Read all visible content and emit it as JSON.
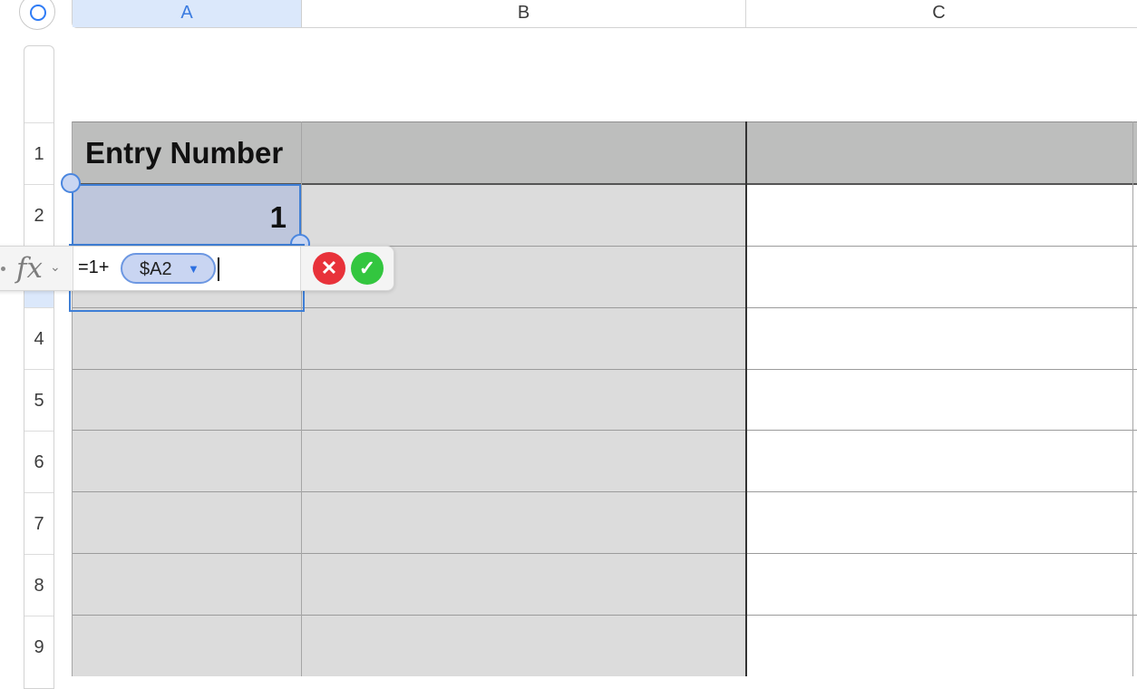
{
  "columns": [
    {
      "label": "A",
      "selected": true
    },
    {
      "label": "B",
      "selected": false
    },
    {
      "label": "C",
      "selected": false
    }
  ],
  "rows": [
    "1",
    "2",
    "",
    "4",
    "5",
    "6",
    "7",
    "8",
    "9"
  ],
  "table": {
    "header_a": "Entry Number",
    "a2_value": "1"
  },
  "formula_bar": {
    "fx_label": "fx",
    "chevron": "⌄",
    "prefix": "=1+",
    "reference_token": "$A2",
    "token_arrow": "▼",
    "cancel_symbol": "✕",
    "accept_symbol": "✓"
  },
  "colors": {
    "selection": "#3f7fd6",
    "header_fill": "#bdbebd",
    "body_fill": "#dcdcdc",
    "cancel": "#e8323a",
    "accept": "#33c63f"
  },
  "icons": [
    "select-all-icon",
    "function-icon",
    "chevron-down-icon",
    "dropdown-arrow-icon",
    "cancel-icon",
    "checkmark-icon"
  ]
}
